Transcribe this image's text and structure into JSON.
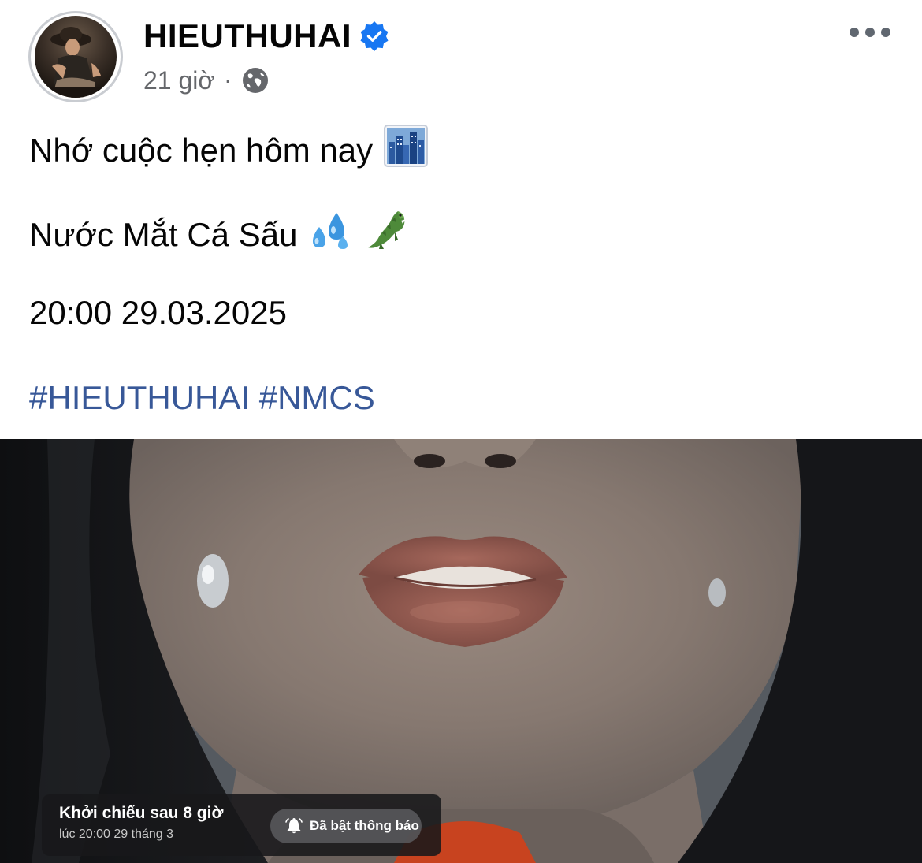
{
  "post": {
    "author": "HIEUTHUHAI",
    "time": "21 giờ",
    "separator": "·",
    "audience_icon": "globe-icon",
    "verified_icon": "verified-badge-icon",
    "more_icon": "more-options-icon",
    "lines": [
      "Nhớ cuộc hẹn hôm nay",
      "Nước Mắt Cá Sấu",
      "20:00 29.03.2025"
    ],
    "emojis": {
      "line1": "🌆",
      "line2_a": "💦",
      "line2_b": "🐊"
    },
    "hashtags": [
      "#HIEUTHUHAI",
      "#NMCS"
    ]
  },
  "premiere": {
    "title": "Khởi chiếu sau 8 giờ",
    "subtitle": "lúc 20:00 29 tháng 3",
    "notify_label": "Đã bật thông báo",
    "notify_icon": "bell-icon"
  },
  "colors": {
    "hashtag": "#385898",
    "verified": "#1877f2",
    "meta_text": "#65676b"
  }
}
